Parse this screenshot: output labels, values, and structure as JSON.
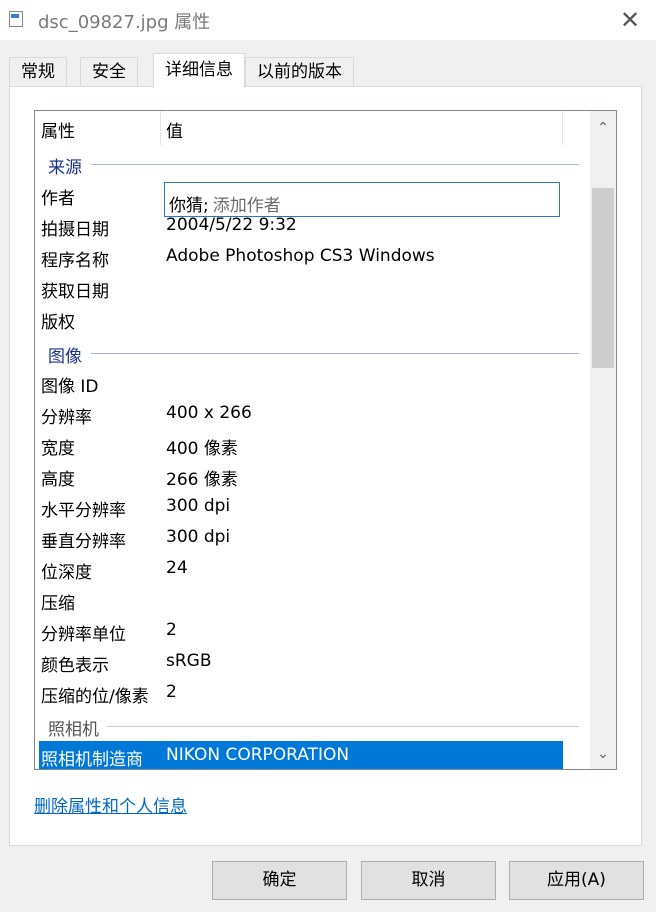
{
  "window": {
    "title": "dsc_09827.jpg 属性",
    "close_glyph": "✕"
  },
  "tabs": [
    {
      "label": "常规"
    },
    {
      "label": "安全"
    },
    {
      "label": "详细信息"
    },
    {
      "label": "以前的版本"
    }
  ],
  "active_tab": "详细信息",
  "columns": {
    "property": "属性",
    "value": "值"
  },
  "groups": {
    "source": "来源",
    "image": "图像",
    "camera": "照相机"
  },
  "author": {
    "value": "你猜;",
    "placeholder": "添加作者"
  },
  "source_rows": [
    {
      "key": "作者",
      "value": ""
    },
    {
      "key": "拍摄日期",
      "value": "2004/5/22 9:32"
    },
    {
      "key": "程序名称",
      "value": "Adobe Photoshop CS3 Windows"
    },
    {
      "key": "获取日期",
      "value": ""
    },
    {
      "key": "版权",
      "value": ""
    }
  ],
  "image_rows": [
    {
      "key": "图像 ID",
      "value": ""
    },
    {
      "key": "分辨率",
      "value": "400 x 266"
    },
    {
      "key": "宽度",
      "value": "400 像素"
    },
    {
      "key": "高度",
      "value": "266 像素"
    },
    {
      "key": "水平分辨率",
      "value": "300 dpi"
    },
    {
      "key": "垂直分辨率",
      "value": "300 dpi"
    },
    {
      "key": "位深度",
      "value": "24"
    },
    {
      "key": "压缩",
      "value": ""
    },
    {
      "key": "分辨率单位",
      "value": "2"
    },
    {
      "key": "颜色表示",
      "value": "sRGB"
    },
    {
      "key": "压缩的位/像素",
      "value": "2"
    }
  ],
  "camera_rows": [
    {
      "key": "照相机制造商",
      "value": "NIKON CORPORATION",
      "selected": true
    }
  ],
  "scroll": {
    "up_glyph": "⌃",
    "down_glyph": "⌄",
    "position_fraction": 0.12
  },
  "link_text": "删除属性和个人信息",
  "buttons": {
    "ok": "确定",
    "cancel": "取消",
    "apply": "应用(A)"
  },
  "colors": {
    "selection": "#0078d7",
    "link": "#0066cc",
    "group_header": "#1e3287"
  }
}
